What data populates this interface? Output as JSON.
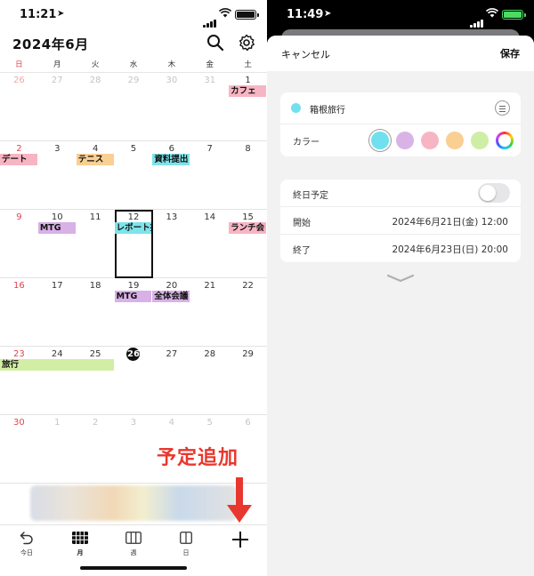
{
  "left": {
    "status": {
      "time": "11:21"
    },
    "header": {
      "title": "2024年6月"
    },
    "weekdays": [
      "日",
      "月",
      "火",
      "水",
      "木",
      "金",
      "土"
    ],
    "weeks": [
      {
        "days": [
          "26",
          "27",
          "28",
          "29",
          "30",
          "31",
          "1"
        ],
        "other": [
          true,
          true,
          true,
          true,
          true,
          true,
          false
        ]
      },
      {
        "days": [
          "2",
          "3",
          "4",
          "5",
          "6",
          "7",
          "8"
        ],
        "other": [
          false,
          false,
          false,
          false,
          false,
          false,
          false
        ]
      },
      {
        "days": [
          "9",
          "10",
          "11",
          "12",
          "13",
          "14",
          "15"
        ],
        "other": [
          false,
          false,
          false,
          false,
          false,
          false,
          false
        ]
      },
      {
        "days": [
          "16",
          "17",
          "18",
          "19",
          "20",
          "21",
          "22"
        ],
        "other": [
          false,
          false,
          false,
          false,
          false,
          false,
          false
        ]
      },
      {
        "days": [
          "23",
          "24",
          "25",
          "26",
          "27",
          "28",
          "29"
        ],
        "other": [
          false,
          false,
          false,
          false,
          false,
          false,
          false
        ]
      },
      {
        "days": [
          "30",
          "1",
          "2",
          "3",
          "4",
          "5",
          "6"
        ],
        "other": [
          false,
          true,
          true,
          true,
          true,
          true,
          true
        ]
      }
    ],
    "today": {
      "week": 4,
      "col": 3
    },
    "selected": {
      "week": 2,
      "col": 3
    },
    "events": [
      {
        "label": "カフェ",
        "week": 0,
        "col": 6,
        "span": 1,
        "color": "#f7b5c4"
      },
      {
        "label": "デート",
        "week": 1,
        "col": 0,
        "span": 1,
        "color": "#f7b5c4"
      },
      {
        "label": "テニス",
        "week": 1,
        "col": 2,
        "span": 1,
        "color": "#f9cf93"
      },
      {
        "label": "資料提出",
        "week": 1,
        "col": 4,
        "span": 1,
        "color": "#7fe3ea"
      },
      {
        "label": "MTG",
        "week": 2,
        "col": 1,
        "span": 1,
        "color": "#d8b1e6"
      },
      {
        "label": "レポート提出",
        "week": 2,
        "col": 3,
        "span": 1,
        "color": "#7fe3ea"
      },
      {
        "label": "ランチ会",
        "week": 2,
        "col": 6,
        "span": 1,
        "color": "#f7b5c4"
      },
      {
        "label": "MTG",
        "week": 3,
        "col": 3,
        "span": 1,
        "color": "#d8b1e6"
      },
      {
        "label": "全体会議",
        "week": 3,
        "col": 4,
        "span": 1,
        "color": "#d8b1e6"
      },
      {
        "label": "旅行",
        "week": 4,
        "col": 0,
        "span": 3,
        "color": "#d2eda4"
      }
    ],
    "annotation": "予定追加",
    "tabs": [
      {
        "label": "今日",
        "icon": "undo-arrow-icon"
      },
      {
        "label": "月",
        "icon": "month-grid-icon"
      },
      {
        "label": "週",
        "icon": "week-columns-icon"
      },
      {
        "label": "日",
        "icon": "day-view-icon"
      },
      {
        "label": "",
        "icon": "plus-icon"
      }
    ]
  },
  "right": {
    "status": {
      "time": "11:49"
    },
    "cancel_label": "キャンセル",
    "save_label": "保存",
    "event_title": "箱根旅行",
    "title_color": "#6fe0ee",
    "color_label": "カラー",
    "colors": [
      "#6fe0ee",
      "#d9b3e6",
      "#f7b5c4",
      "#f9cf93",
      "#cfeea5",
      "rainbow"
    ],
    "selected_color_index": 0,
    "all_day_label": "終日予定",
    "all_day": false,
    "start_label": "開始",
    "start_value": "2024年6月21日(金) 12:00",
    "end_label": "終了",
    "end_value": "2024年6月23日(日) 20:00"
  }
}
